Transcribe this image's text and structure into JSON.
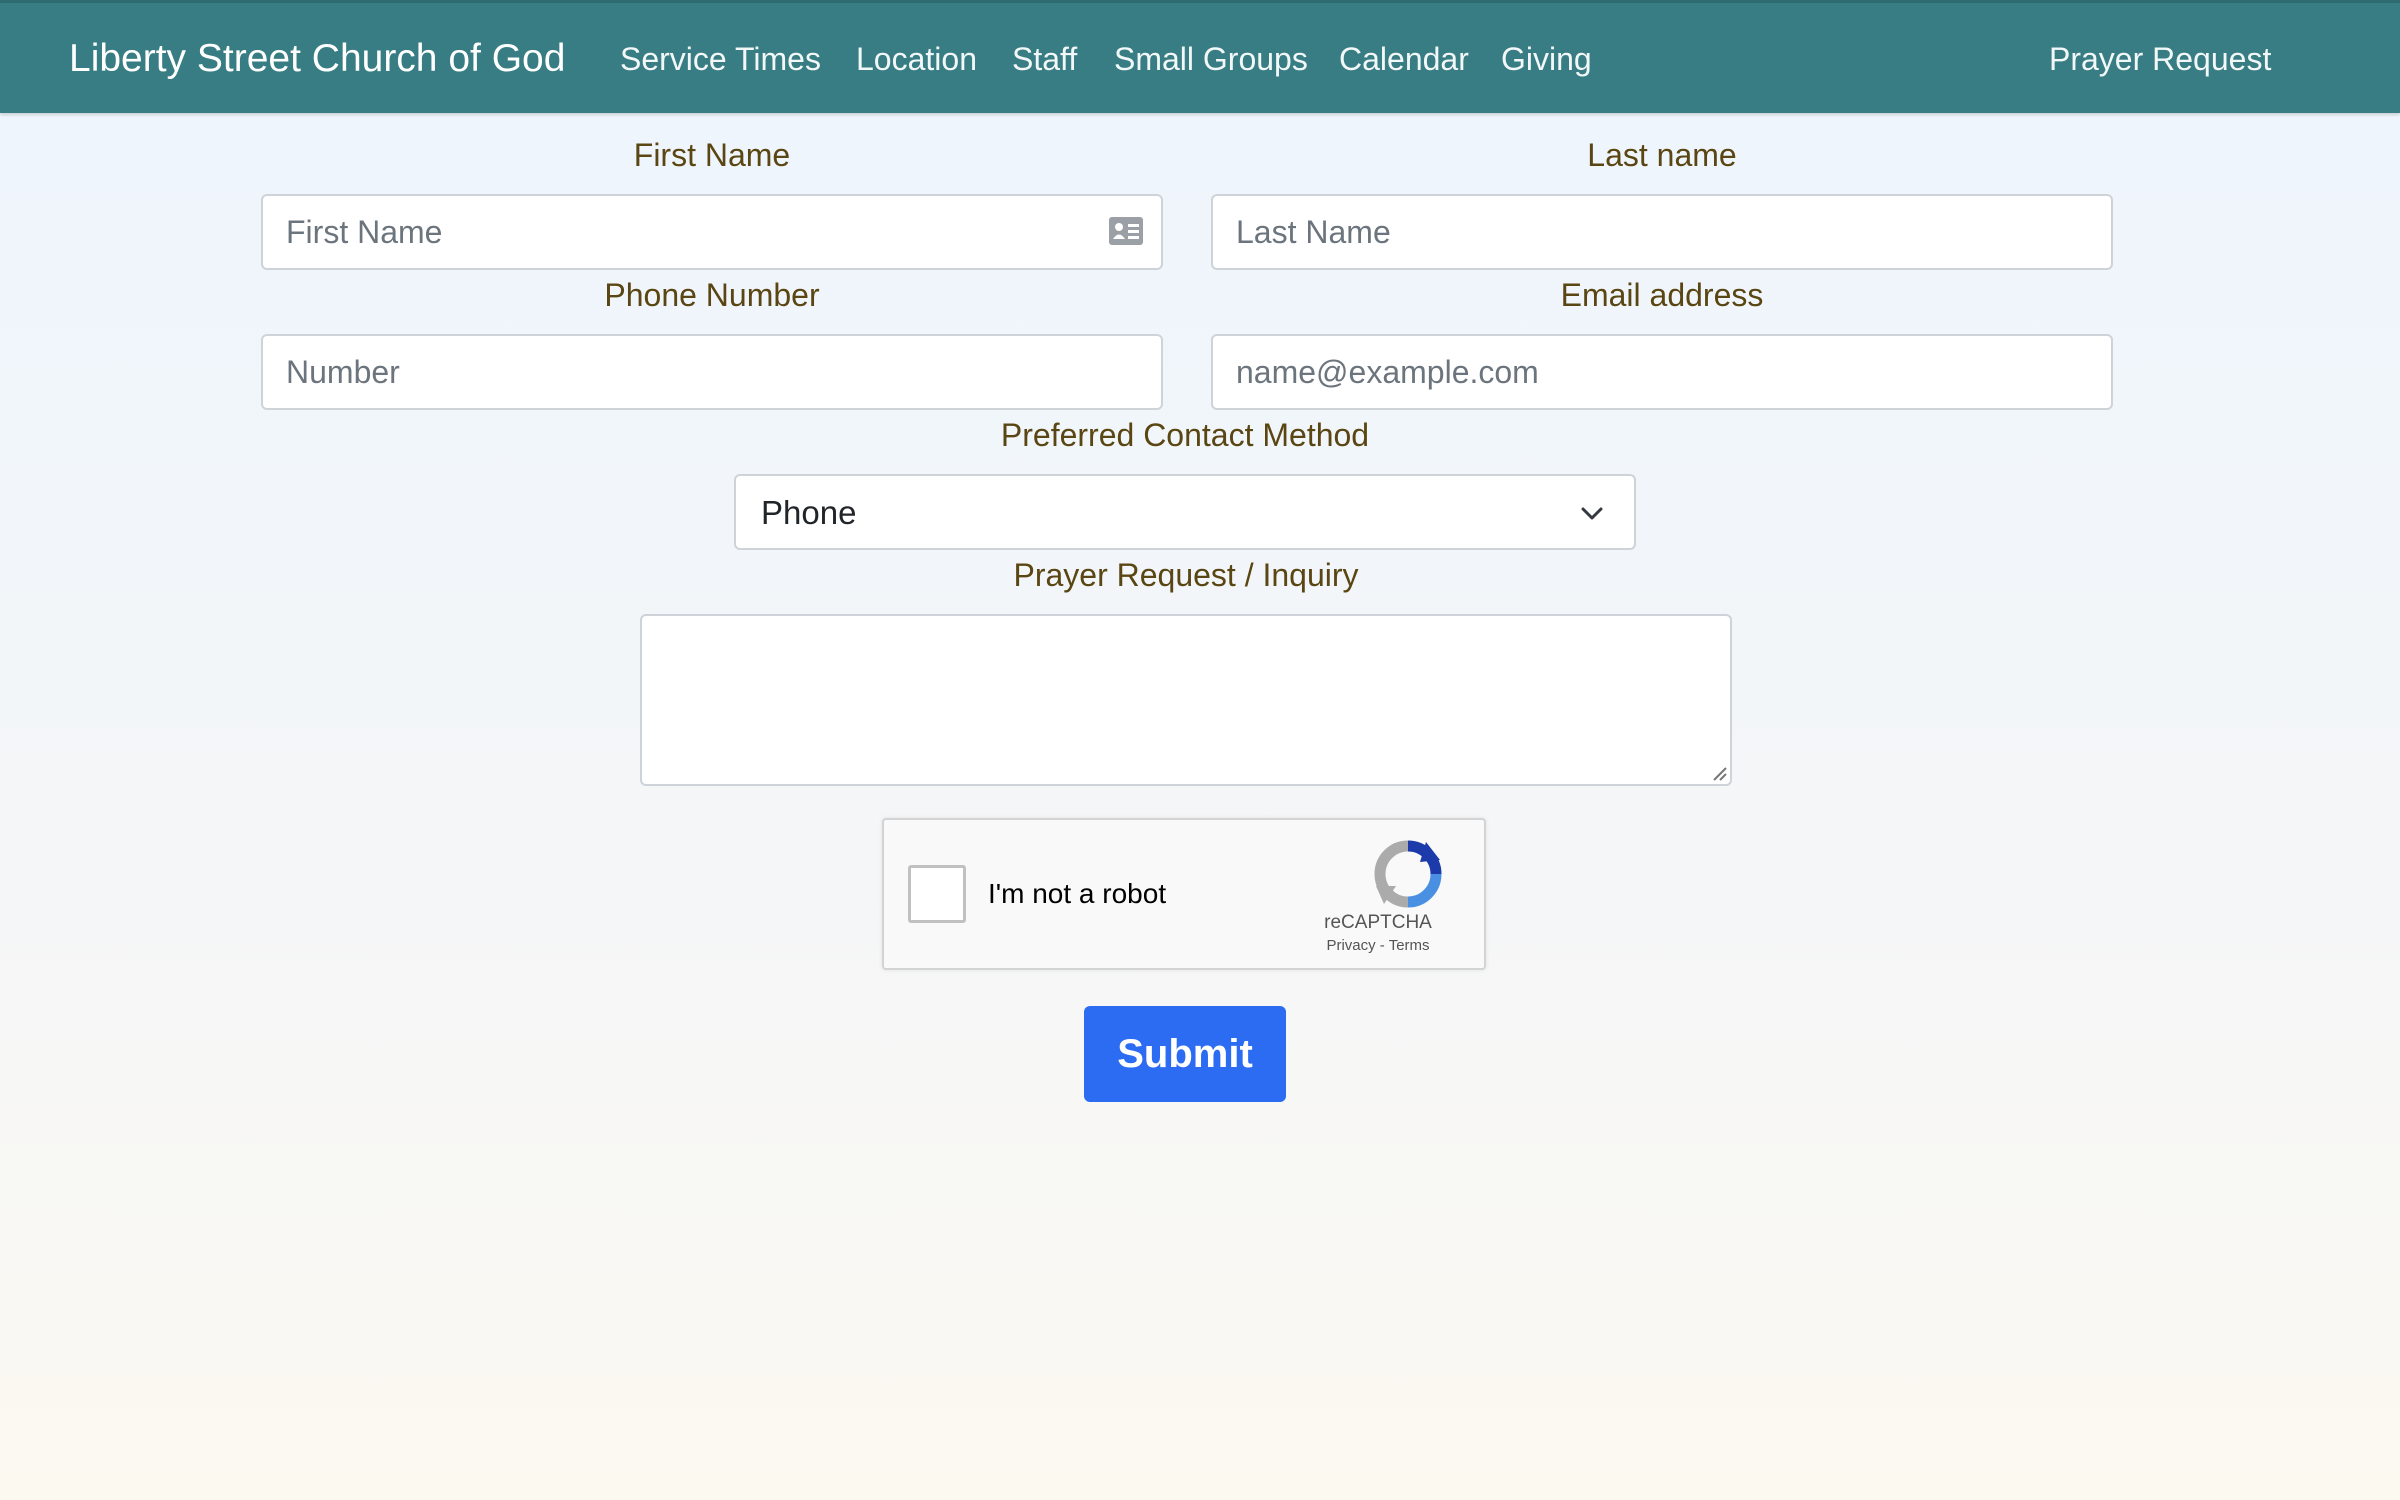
{
  "navbar": {
    "brand": "Liberty Street Church of God",
    "links": [
      "Service Times",
      "Location",
      "Staff",
      "Small Groups",
      "Calendar",
      "Giving"
    ],
    "right_link": "Prayer Request",
    "color": "#377d83"
  },
  "form": {
    "first_name": {
      "label": "First Name",
      "placeholder": "First Name",
      "icon": "contact-card-icon"
    },
    "last_name": {
      "label": "Last name",
      "placeholder": "Last Name"
    },
    "phone": {
      "label": "Phone Number",
      "placeholder": "Number"
    },
    "email": {
      "label": "Email address",
      "placeholder": "name@example.com"
    },
    "contact_method": {
      "label": "Preferred Contact Method",
      "value": "Phone"
    },
    "message": {
      "label": "Prayer Request / Inquiry",
      "value": ""
    },
    "captcha": {
      "text": "I'm not a robot",
      "brand": "reCAPTCHA",
      "privacy": "Privacy",
      "separator": " - ",
      "terms": "Terms"
    },
    "submit_label": "Submit",
    "submit_color": "#2b6cf2",
    "label_color": "#5a4612"
  }
}
